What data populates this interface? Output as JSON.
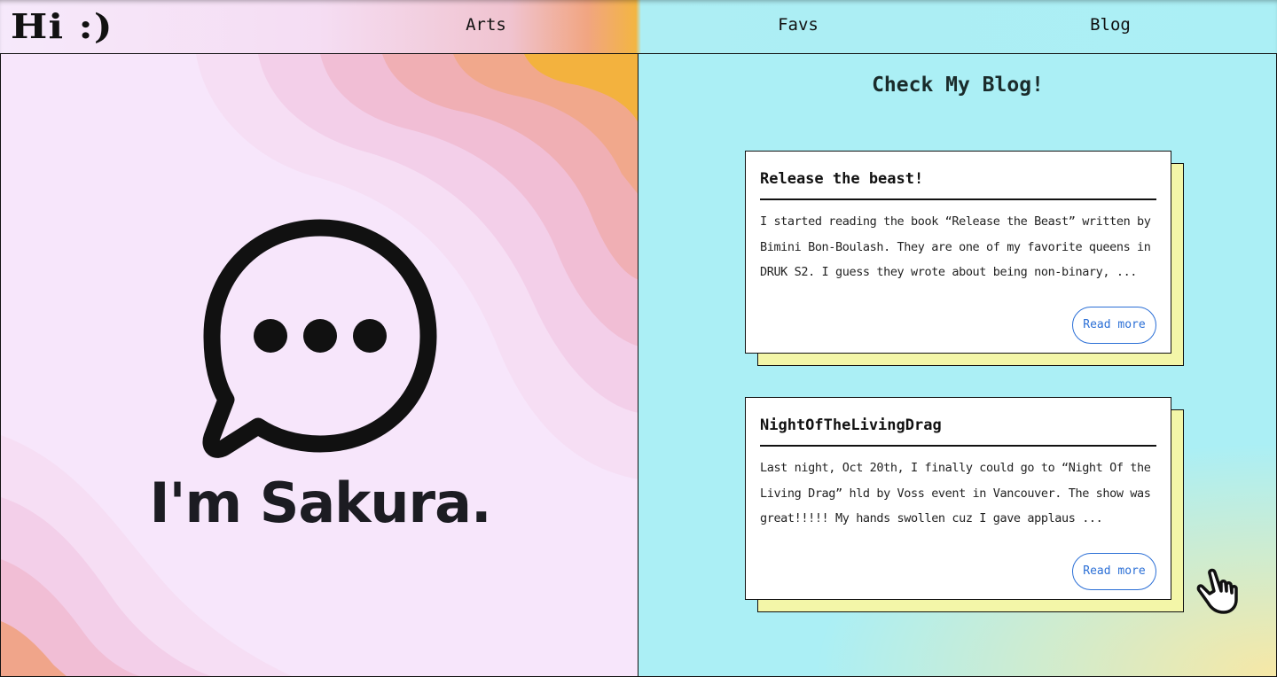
{
  "header": {
    "logo_text": "Hi :)",
    "nav": [
      {
        "label": "Arts"
      },
      {
        "label": "Favs"
      },
      {
        "label": "Blog"
      }
    ]
  },
  "hero": {
    "icon": "chat-bubble-dots-icon",
    "name": "I'm Sakura."
  },
  "blog": {
    "heading": "Check My Blog!",
    "posts": [
      {
        "title": "Release the beast!",
        "excerpt": "I started reading the book “Release the Beast” written by Bimini Bon-Boulash. They are one of my favorite queens in DRUK S2. I guess they wrote about being non-binary, ...",
        "button": "Read more"
      },
      {
        "title": "NightOfTheLivingDrag",
        "excerpt": "Last night, Oct 20th, I finally could go to “Night Of the Living Drag” hld by Voss event in Vancouver. The show was great!!!!! My hands swollen cuz I gave applaus ...",
        "button": "Read more"
      }
    ]
  },
  "cursor": {
    "icon": "pointing-hand-cursor-icon"
  },
  "colors": {
    "left_bg": "#f7e6fb",
    "wave_pink": "#f2c4e2",
    "wave_peach": "#f0a58a",
    "wave_orange": "#f3b23e",
    "right_bg": "#abeff5",
    "card_shadow": "#f3f6a8",
    "link_blue": "#2b6fd6"
  }
}
